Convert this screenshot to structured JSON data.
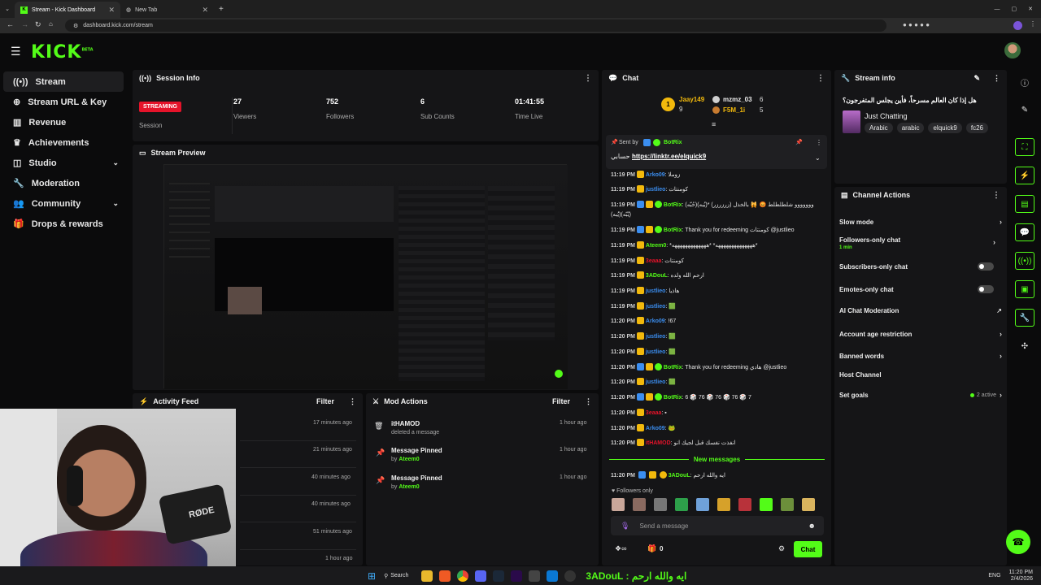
{
  "browser": {
    "tabs": [
      {
        "title": "Stream - Kick Dashboard"
      },
      {
        "title": "New Tab"
      }
    ],
    "url": "dashboard.kick.com/stream"
  },
  "brand": {
    "logo": "KICK",
    "beta": "BETA",
    "accent": "#53fc18"
  },
  "sidebar": {
    "items": [
      {
        "label": "Stream",
        "icon": "stream-icon"
      },
      {
        "label": "Stream URL & Key",
        "icon": "globe-icon"
      },
      {
        "label": "Revenue",
        "icon": "chart-icon"
      },
      {
        "label": "Achievements",
        "icon": "trophy-icon"
      },
      {
        "label": "Studio",
        "icon": "studio-icon"
      },
      {
        "label": "Moderation",
        "icon": "wrench-icon"
      },
      {
        "label": "Community",
        "icon": "users-icon"
      },
      {
        "label": "Drops & rewards",
        "icon": "gift-icon"
      }
    ]
  },
  "session": {
    "title": "Session Info",
    "status": "STREAMING",
    "status_label": "Session",
    "stats": [
      {
        "value": "27",
        "label": "Viewers"
      },
      {
        "value": "752",
        "label": "Followers"
      },
      {
        "value": "6",
        "label": "Sub Counts"
      },
      {
        "value": "01:41:55",
        "label": "Time Live"
      }
    ]
  },
  "preview": {
    "title": "Stream Preview"
  },
  "activity": {
    "title": "Activity Feed",
    "filter": "Filter",
    "times": [
      "17 minutes ago",
      "21 minutes ago",
      "40 minutes ago",
      "40 minutes ago",
      "51 minutes ago",
      "1 hour ago"
    ]
  },
  "mod_actions": {
    "title": "Mod Actions",
    "filter": "Filter",
    "items": [
      {
        "title": "itHAMOD",
        "sub": "deleted a message",
        "by": "",
        "time": "1 hour ago",
        "icon": "trash-icon"
      },
      {
        "title": "Message Pinned",
        "sub": "by",
        "by": "Ateem0",
        "time": "1 hour ago",
        "icon": "pin-icon"
      },
      {
        "title": "Message Pinned",
        "sub": "by",
        "by": "Ateem0",
        "time": "1 hour ago",
        "icon": "pin-icon"
      }
    ]
  },
  "chat": {
    "title": "Chat",
    "gifters": [
      {
        "name": "Jaay149",
        "count": "9"
      },
      {
        "name": "mzmz_03",
        "count": "6"
      },
      {
        "name": "F5M_1i",
        "count": "5"
      }
    ],
    "pinned": {
      "sent_by": "Sent by",
      "user": "BotRix",
      "text": "حسابي",
      "link": "https://linktr.ee/elquick9"
    },
    "messages": [
      {
        "time": "11:19 PM",
        "user": "Arko09",
        "color": "#3b8ef0",
        "text": ": زوملا"
      },
      {
        "time": "11:19 PM",
        "user": "justlieo",
        "color": "#3b8ef0",
        "text": ": كومنتات"
      },
      {
        "time": "11:19 PM",
        "user": "BotRix",
        "color": "#53fc18",
        "text": ": (حُبّه)(يُبه)* (زرزرزر) ووووووو شلطلطلط 😡 🙀 بالخذل"
      },
      {
        "time": "",
        "user": "",
        "color": "",
        "text": "(يُبه)(يُبّه)"
      },
      {
        "time": "11:19 PM",
        "user": "BotRix",
        "color": "#53fc18",
        "text": ": Thank you for redeeming كومنتات @justlieo"
      },
      {
        "time": "11:19 PM",
        "user": "Ateem0",
        "color": "#53fc18",
        "text": ": *ههههههههههههههه* *هههههههههههههه*"
      },
      {
        "time": "11:19 PM",
        "user": "3eaaa",
        "color": "#e5132a",
        "text": ": كومنتات"
      },
      {
        "time": "11:19 PM",
        "user": "3ADouL",
        "color": "#53fc18",
        "text": ": ارحم الله ولده"
      },
      {
        "time": "11:19 PM",
        "user": "justlieo",
        "color": "#3b8ef0",
        "text": ": هاذيا"
      },
      {
        "time": "11:19 PM",
        "user": "justlieo",
        "color": "#3b8ef0",
        "text": ": 🟩"
      },
      {
        "time": "11:20 PM",
        "user": "Arko09",
        "color": "#3b8ef0",
        "text": ": !67"
      },
      {
        "time": "11:20 PM",
        "user": "justlieo",
        "color": "#3b8ef0",
        "text": ": 🟩"
      },
      {
        "time": "11:20 PM",
        "user": "justlieo",
        "color": "#3b8ef0",
        "text": ": 🟩"
      },
      {
        "time": "11:20 PM",
        "user": "BotRix",
        "color": "#53fc18",
        "text": ": Thank you for redeeming هادي @justlieo"
      },
      {
        "time": "11:20 PM",
        "user": "justlieo",
        "color": "#3b8ef0",
        "text": ": 🟩"
      },
      {
        "time": "11:20 PM",
        "user": "BotRix",
        "color": "#53fc18",
        "text": ": 6 🎲 76 🎲 76 🎲 76 🎲 7"
      },
      {
        "time": "11:20 PM",
        "user": "3eaaa",
        "color": "#e5132a",
        "text": ": ▪"
      },
      {
        "time": "11:20 PM",
        "user": "Arko09",
        "color": "#3b8ef0",
        "text": ": 🐸"
      },
      {
        "time": "11:20 PM",
        "user": "itHAMOD",
        "color": "#e5132a",
        "text": ": انفذت نفسك قبل لجيك انو"
      }
    ],
    "new_messages": "New messages",
    "latest": {
      "time": "11:20 PM",
      "user": "3ADouL",
      "color": "#53fc18",
      "text": ": ايه والله ارحم"
    },
    "followers_only": "Followers only",
    "placeholder": "Send a message",
    "counter": "0",
    "send": "Chat"
  },
  "stream_info": {
    "title": "Stream info",
    "stream_title": "هل إذا كان العالم مسرحاً، فأين يجلس المتفرجون؟",
    "category": "Just Chatting",
    "tags": [
      "Arabic",
      "arabic",
      "elquick9",
      "fc26"
    ]
  },
  "channel_actions": {
    "title": "Channel Actions",
    "items": [
      {
        "label": "Slow mode",
        "kind": "arrow",
        "sub": "",
        "extra": ""
      },
      {
        "label": "Followers-only chat",
        "kind": "arrow",
        "sub": "1 min",
        "extra": ""
      },
      {
        "label": "Subscribers-only chat",
        "kind": "toggle",
        "sub": "",
        "extra": ""
      },
      {
        "label": "Emotes-only chat",
        "kind": "toggle",
        "sub": "",
        "extra": ""
      },
      {
        "label": "AI Chat Moderation",
        "kind": "external",
        "sub": "",
        "extra": ""
      },
      {
        "label": "Account age restriction",
        "kind": "arrow",
        "sub": "",
        "extra": ""
      },
      {
        "label": "Banned words",
        "kind": "arrow",
        "sub": "",
        "extra": ""
      },
      {
        "label": "Host Channel",
        "kind": "none",
        "sub": "",
        "extra": ""
      },
      {
        "label": "Set goals",
        "kind": "arrow",
        "sub": "",
        "extra": "2 active"
      }
    ]
  },
  "taskbar": {
    "search": "Search",
    "ticker": "3ADouL : ايه والله ارحم",
    "lang": "ENG",
    "time": "11:20 PM",
    "date": "2/4/2026"
  },
  "webcam_label": "RØDE"
}
